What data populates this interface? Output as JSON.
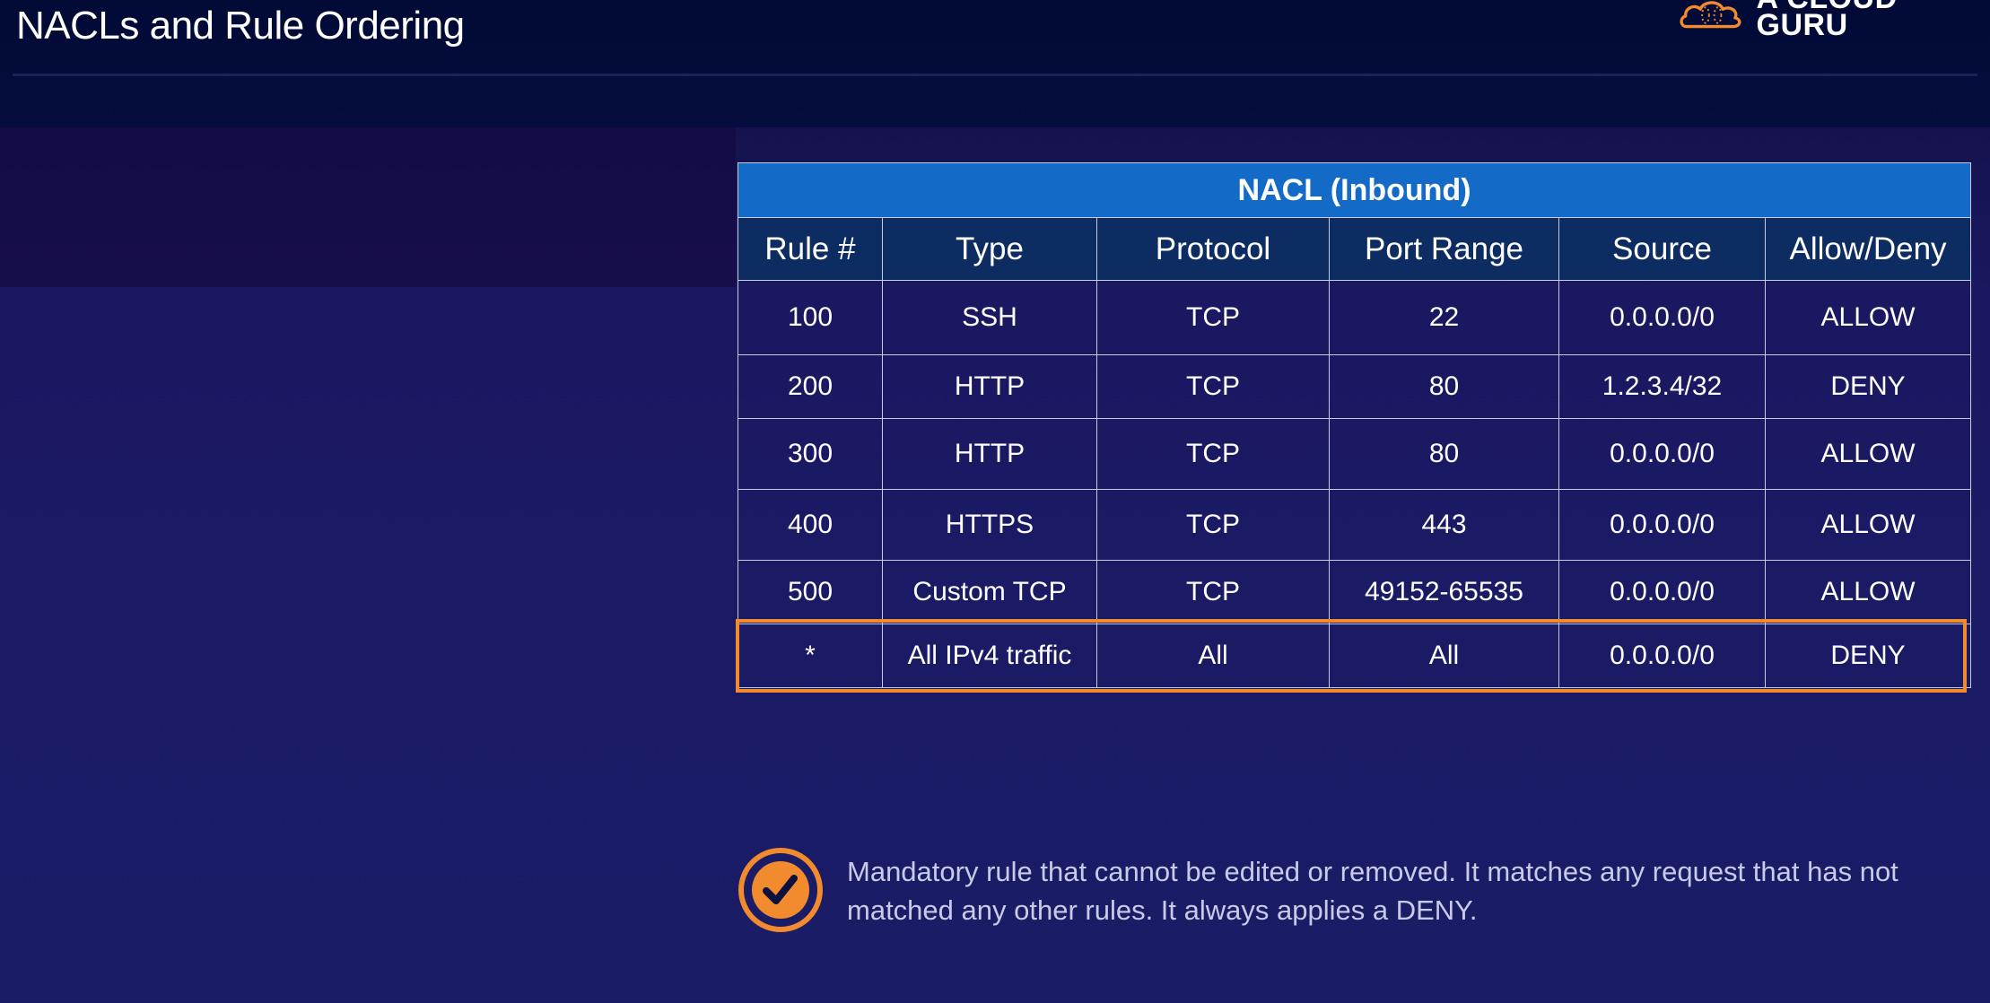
{
  "slide": {
    "title": "NACLs and Rule Ordering"
  },
  "logo": {
    "text": "A CLOUD GURU",
    "icon": "cloud-icon",
    "accent_color": "#f28a2e"
  },
  "table": {
    "caption": "NACL (Inbound)",
    "columns": [
      "Rule #",
      "Type",
      "Protocol",
      "Port Range",
      "Source",
      "Allow/Deny"
    ],
    "rows": [
      [
        "100",
        "SSH",
        "TCP",
        "22",
        "0.0.0.0/0",
        "ALLOW"
      ],
      [
        "200",
        "HTTP",
        "TCP",
        "80",
        "1.2.3.4/32",
        "DENY"
      ],
      [
        "300",
        "HTTP",
        "TCP",
        "80",
        "0.0.0.0/0",
        "ALLOW"
      ],
      [
        "400",
        "HTTPS",
        "TCP",
        "443",
        "0.0.0.0/0",
        "ALLOW"
      ],
      [
        "500",
        "Custom TCP",
        "TCP",
        "49152-65535",
        "0.0.0.0/0",
        "ALLOW"
      ],
      [
        "*",
        "All IPv4 traffic",
        "All",
        "All",
        "0.0.0.0/0",
        "DENY"
      ]
    ],
    "highlighted_row": 5,
    "caption_color": "#136ac7",
    "header_color": "#0d2d62",
    "highlight_color": "#f28a2e"
  },
  "note": {
    "icon": "check-circle-icon",
    "text": "Mandatory rule that cannot be edited or removed. It matches any request that has not matched any other rules. It always applies a DENY."
  }
}
